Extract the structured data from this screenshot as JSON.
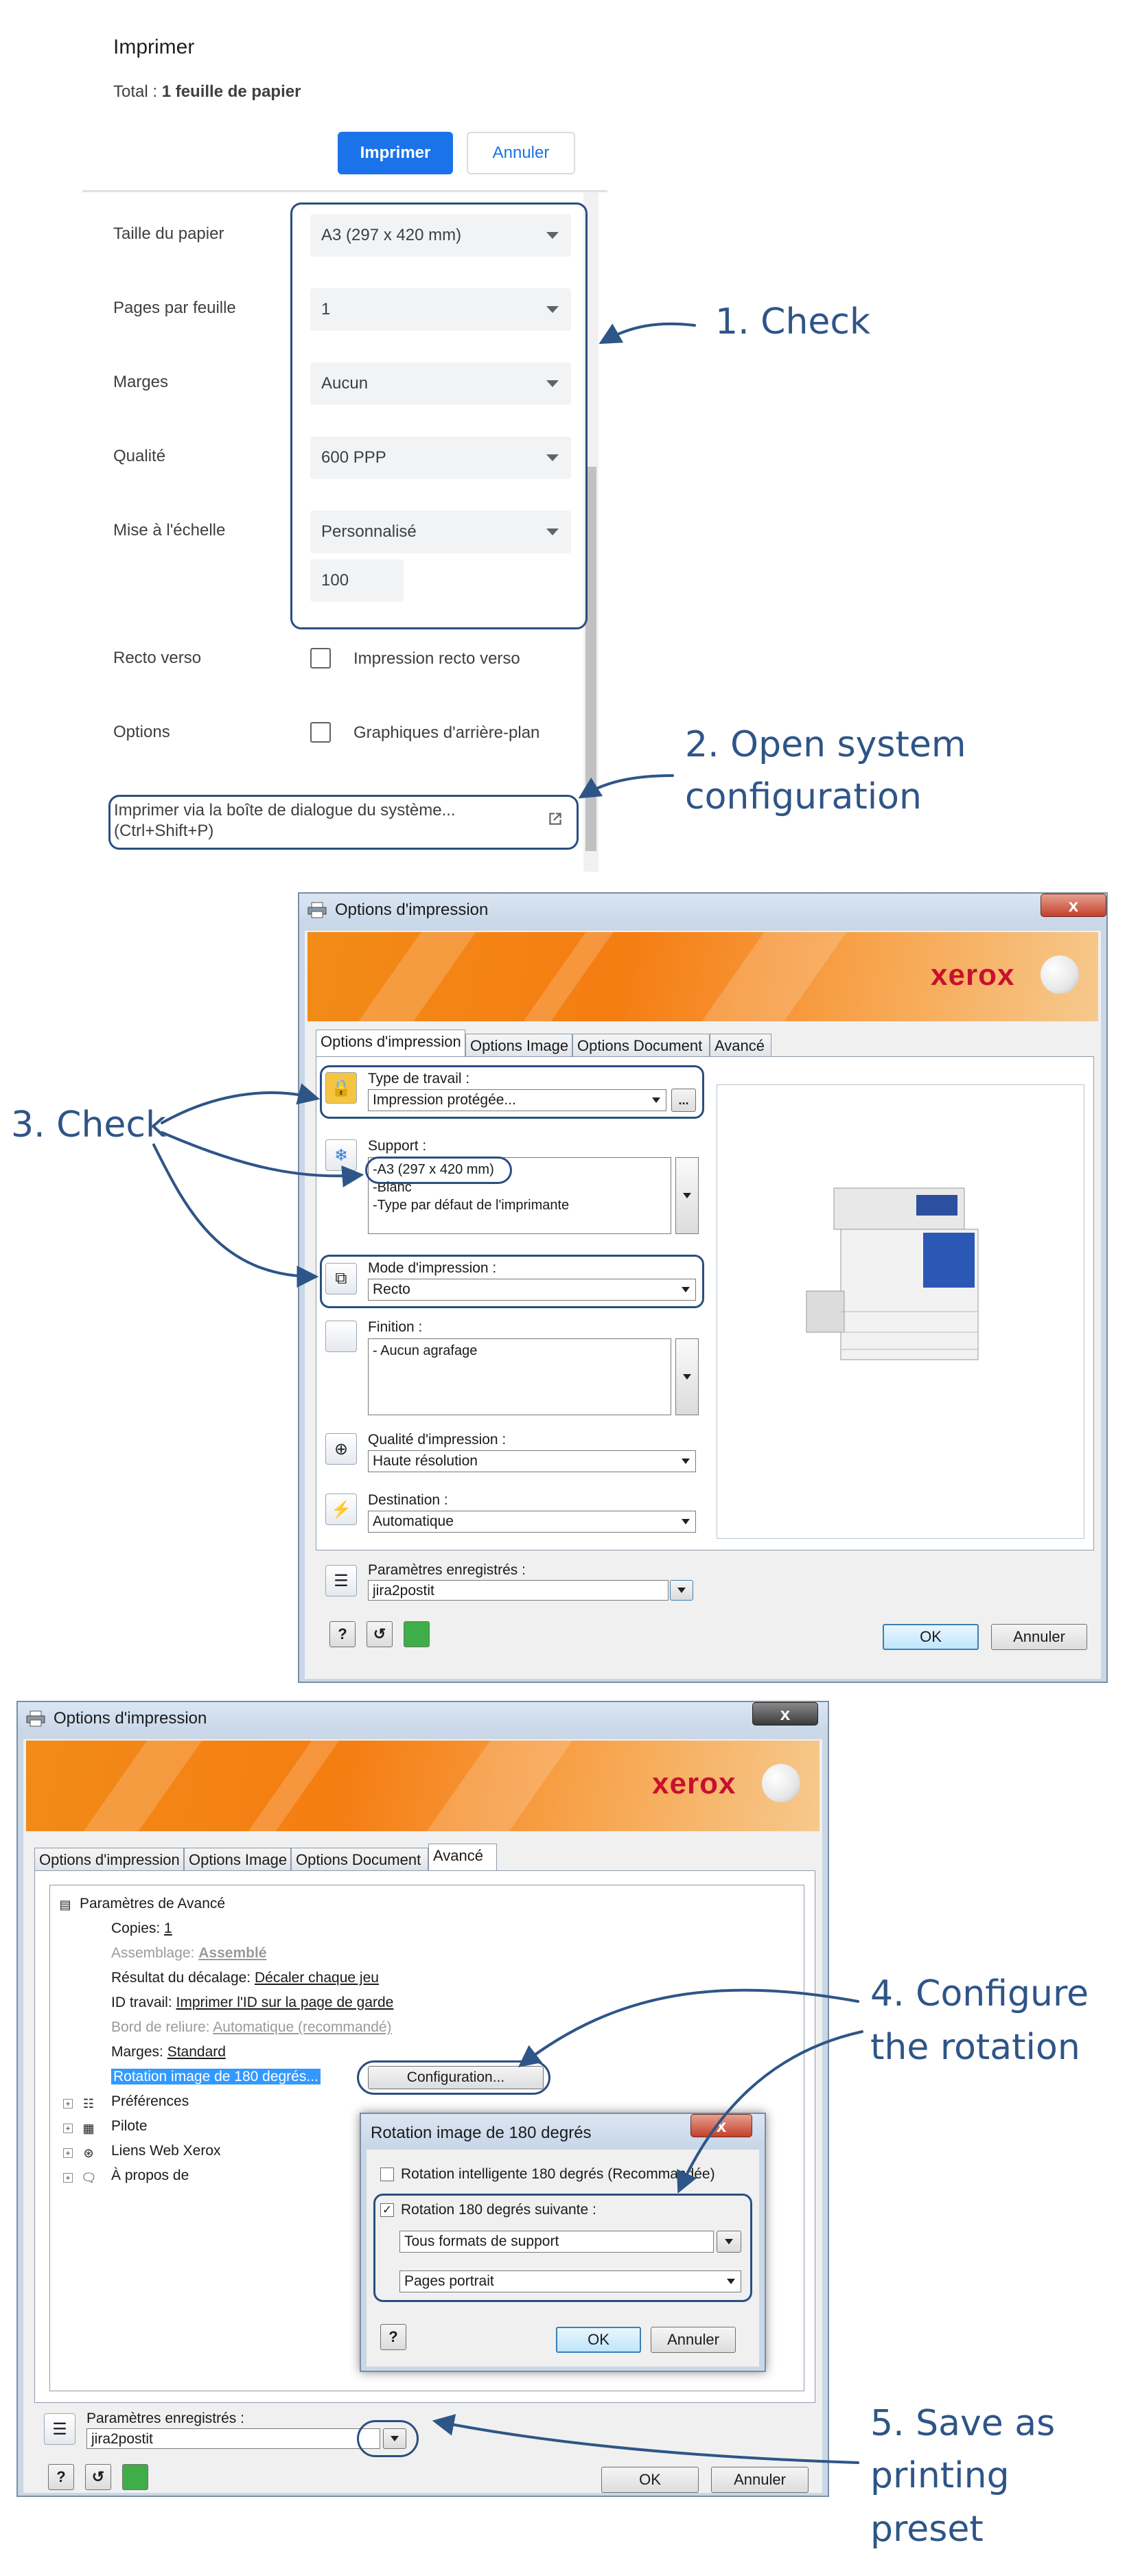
{
  "chrome_print": {
    "title": "Imprimer",
    "total_label": "Total : ",
    "total_value": "1 feuille de papier",
    "print_button": "Imprimer",
    "cancel_button": "Annuler",
    "rows": {
      "paper_size": {
        "label": "Taille du papier",
        "value": "A3 (297 x 420 mm)"
      },
      "pages_per_sheet": {
        "label": "Pages par feuille",
        "value": "1"
      },
      "margins": {
        "label": "Marges",
        "value": "Aucun"
      },
      "quality": {
        "label": "Qualité",
        "value": "600 PPP"
      },
      "scale": {
        "label": "Mise à l'échelle",
        "value": "Personnalisé",
        "custom_value": "100"
      },
      "duplex": {
        "label": "Recto verso",
        "checkbox_label": "Impression recto verso"
      },
      "options": {
        "label": "Options",
        "checkbox_label": "Graphiques d'arrière-plan"
      }
    },
    "system_dialog_line1": "Imprimer via la boîte de dialogue du système...",
    "system_dialog_line2": "(Ctrl+Shift+P)"
  },
  "annotations": {
    "step1": "1. Check",
    "step2_line1": "2. Open system",
    "step2_line2": "configuration",
    "step3": "3. Check",
    "step4_line1": "4. Configure",
    "step4_line2": "the rotation",
    "step5_line1": "5. Save as",
    "step5_line2": "printing preset"
  },
  "dialog1": {
    "title": "Options d'impression",
    "close": "x",
    "brand": "xerox",
    "tabs": [
      "Options d'impression",
      "Options Image",
      "Options Document",
      "Avancé"
    ],
    "job_type_label": "Type de travail :",
    "job_type_value": "Impression protégée...",
    "support_label": "Support :",
    "support_lines": [
      "-A3 (297 x 420 mm)",
      "-Blanc",
      "-Type par défaut de l'imprimante"
    ],
    "print_mode_label": "Mode d'impression :",
    "print_mode_value": "Recto",
    "finishing_label": "Finition :",
    "finishing_lines": [
      "- Aucun agrafage"
    ],
    "quality_label": "Qualité d'impression :",
    "quality_value": "Haute résolution",
    "destination_label": "Destination :",
    "destination_value": "Automatique",
    "saved_settings_label": "Paramètres enregistrés :",
    "saved_settings_value": "jira2postit",
    "help": "?",
    "ok": "OK",
    "cancel": "Annuler",
    "more_button": "..."
  },
  "dialog2": {
    "title": "Options d'impression",
    "close": "x",
    "brand": "xerox",
    "tabs": [
      "Options d'impression",
      "Options Image",
      "Options Document",
      "Avancé"
    ],
    "tree_root": "Paramètres de Avancé",
    "tree_items": [
      {
        "label": "Copies: ",
        "value": "1",
        "disabled": false
      },
      {
        "label": "Assemblage: ",
        "value": "Assemblé",
        "disabled": true
      },
      {
        "label": "Résultat du décalage: ",
        "value": "Décaler chaque jeu",
        "disabled": false
      },
      {
        "label": "ID travail: ",
        "value": "Imprimer l'ID sur la page de garde",
        "disabled": false
      },
      {
        "label": "Bord de reliure: ",
        "value": "Automatique (recommandé)",
        "disabled": true
      },
      {
        "label": "Marges: ",
        "value": "Standard",
        "disabled": false
      }
    ],
    "rotation_item": "Rotation image de 180 degrés...",
    "configuration_button": "Configuration...",
    "tree_groups": [
      "Préférences",
      "Pilote",
      "Liens Web Xerox",
      "À propos de"
    ],
    "saved_settings_label": "Paramètres enregistrés :",
    "saved_settings_value": "jira2postit",
    "help": "?",
    "ok": "OK",
    "cancel": "Annuler"
  },
  "rotation_dialog": {
    "title": "Rotation image de 180 degrés",
    "close": "x",
    "smart_rotation_label": "Rotation intelligente 180 degrés (Recommandée)",
    "rotation_following_label": "Rotation 180 degrés suivante :",
    "rotation_following_checked": "✓",
    "media_value": "Tous formats de support",
    "orientation_value": "Pages portrait",
    "help": "?",
    "ok": "OK",
    "cancel": "Annuler"
  },
  "colors": {
    "annotation": "#2e5587",
    "highlight": "#2a4f80",
    "chrome_blue": "#1a73e8",
    "xerox_red": "#c8102e",
    "banner_orange": "#f28b18"
  }
}
